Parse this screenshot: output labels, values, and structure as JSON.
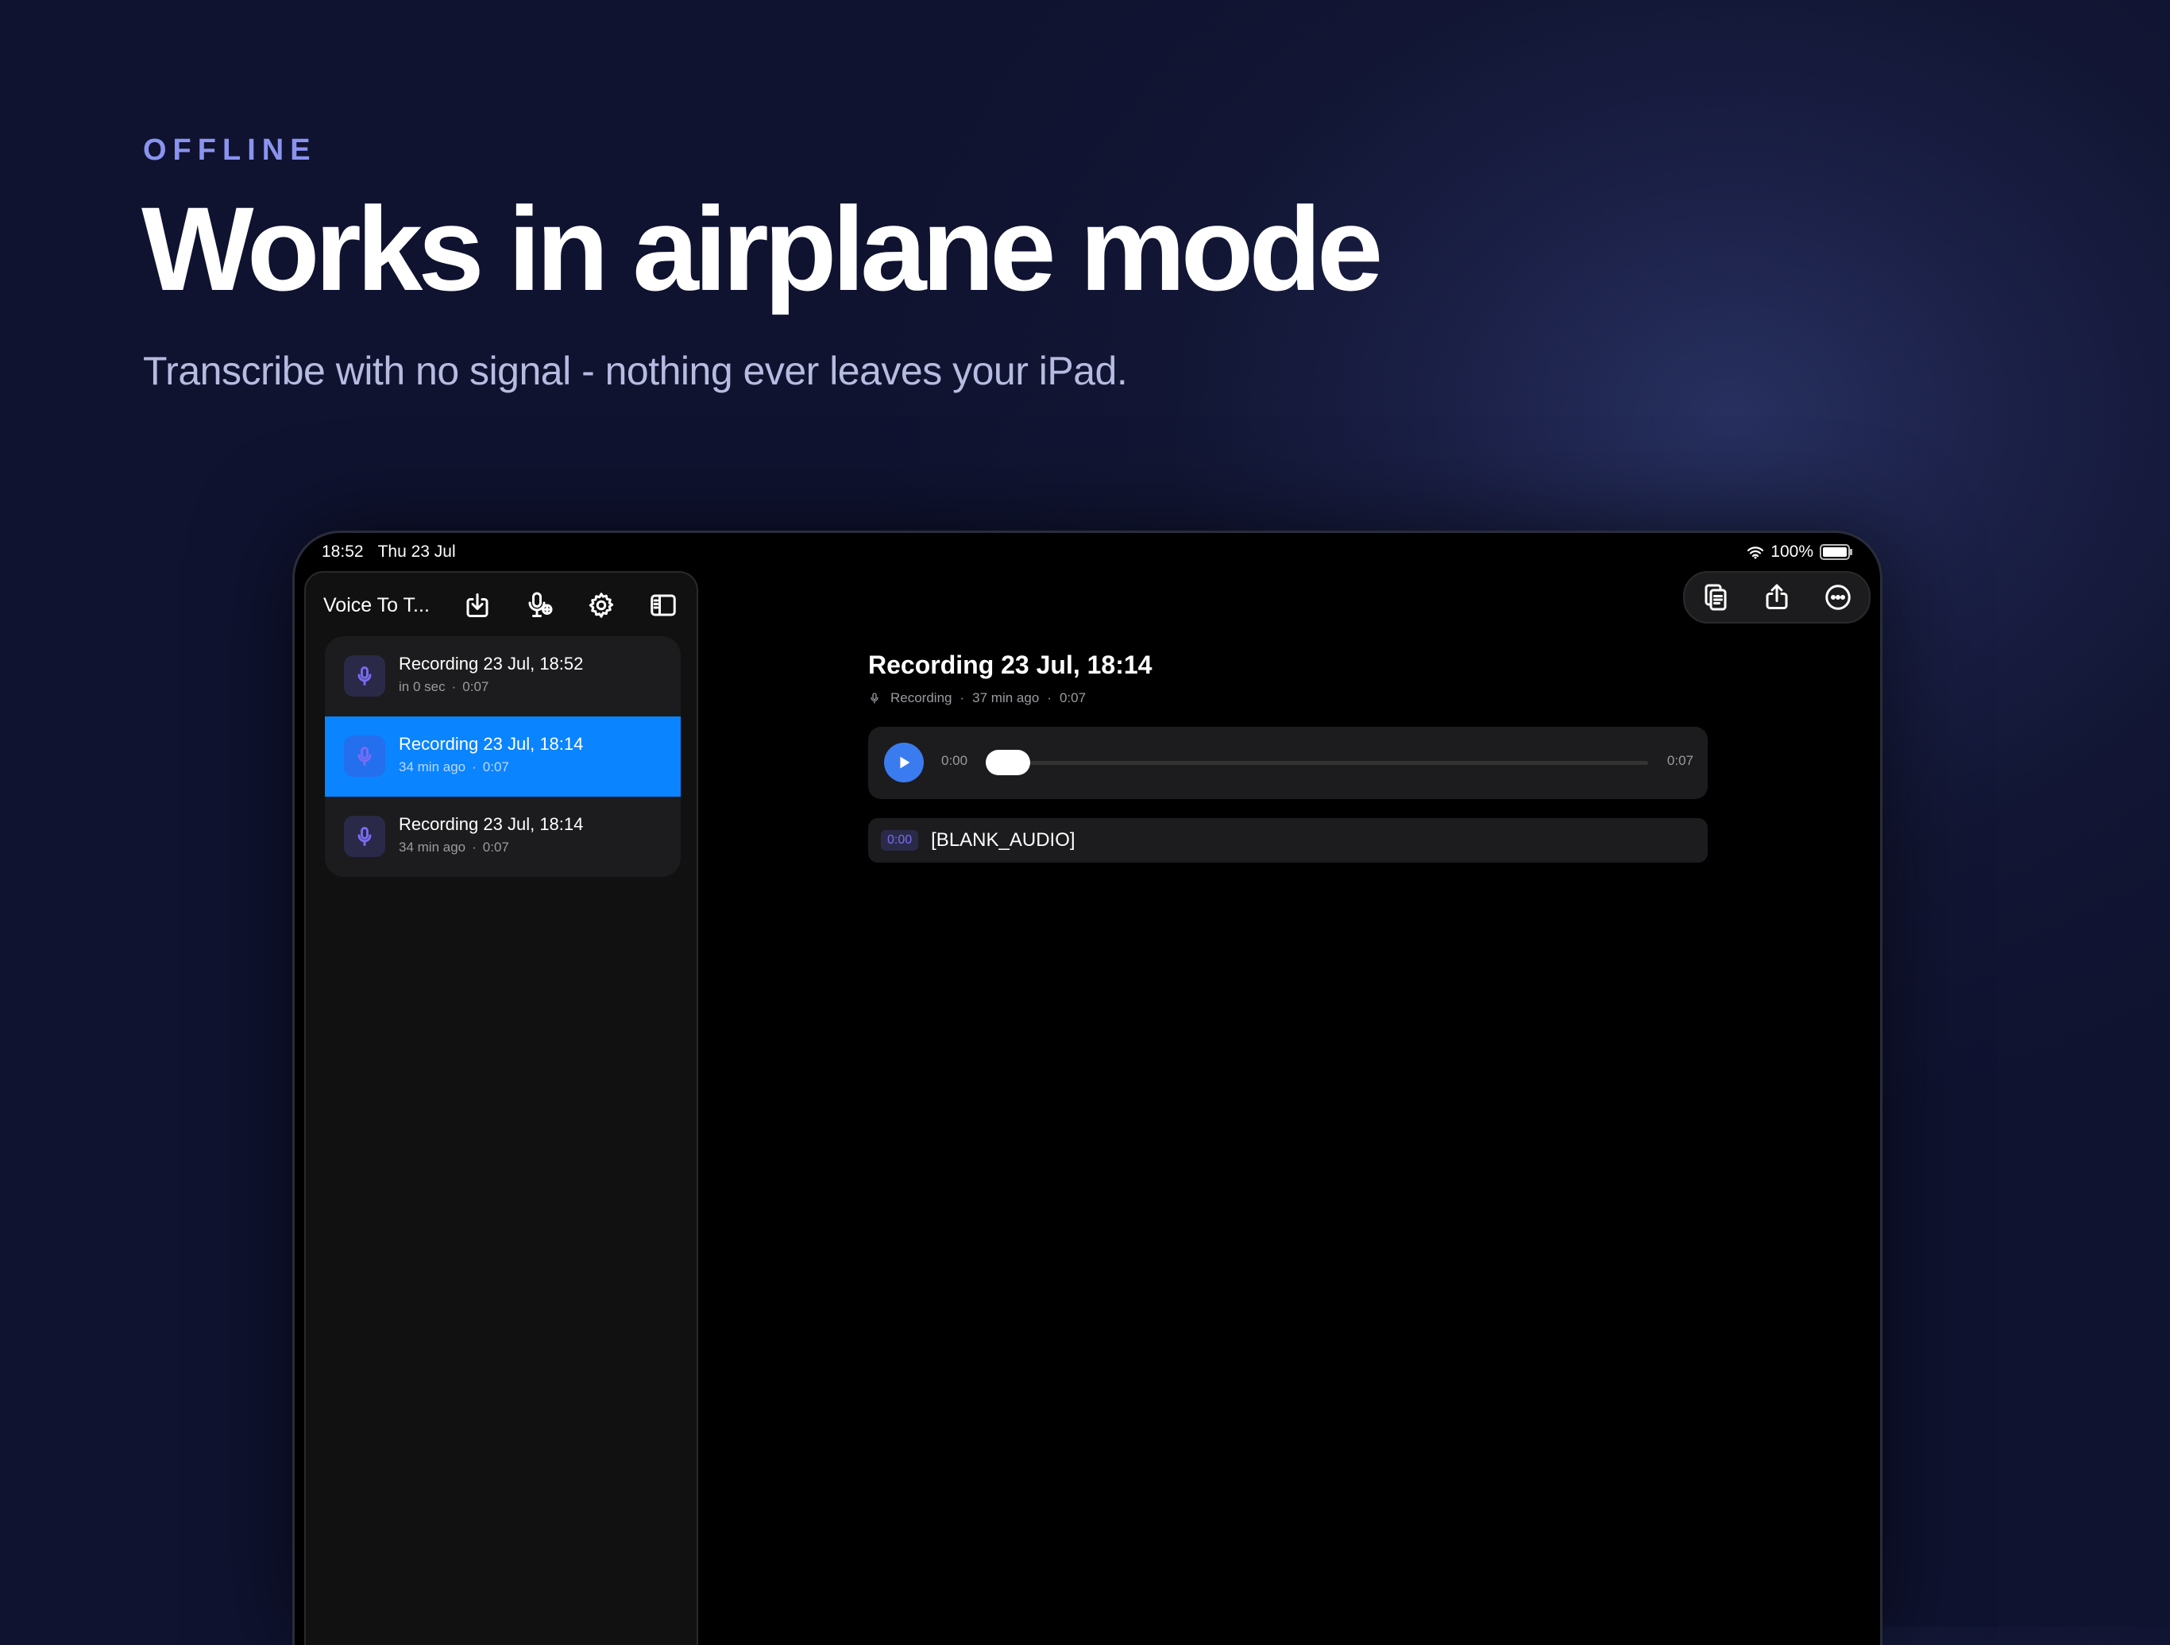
{
  "hero": {
    "eyebrow": "OFFLINE",
    "headline": "Works in airplane mode",
    "subline": "Transcribe with no signal - nothing ever leaves your iPad."
  },
  "status_bar": {
    "time": "18:52",
    "date": "Thu 23 Jul",
    "battery": "100%"
  },
  "sidebar": {
    "title": "Voice To T...",
    "recordings": [
      {
        "title": "Recording 23 Jul, 18:52",
        "ago": "in 0 sec",
        "duration": "0:07",
        "selected": false
      },
      {
        "title": "Recording 23 Jul, 18:14",
        "ago": "34 min ago",
        "duration": "0:07",
        "selected": true
      },
      {
        "title": "Recording 23 Jul, 18:14",
        "ago": "34 min ago",
        "duration": "0:07",
        "selected": false
      }
    ]
  },
  "detail": {
    "title": "Recording 23 Jul, 18:14",
    "meta_type": "Recording",
    "meta_ago": "37 min ago",
    "meta_duration": "0:07",
    "player": {
      "current": "0:00",
      "total": "0:07",
      "progress": 0
    },
    "segments": [
      {
        "time": "0:00",
        "text": "[BLANK_AUDIO]"
      }
    ]
  },
  "colors": {
    "accent": "#0a84ff",
    "eyebrow": "#8b93f0",
    "mic": "#7a6cf2"
  }
}
